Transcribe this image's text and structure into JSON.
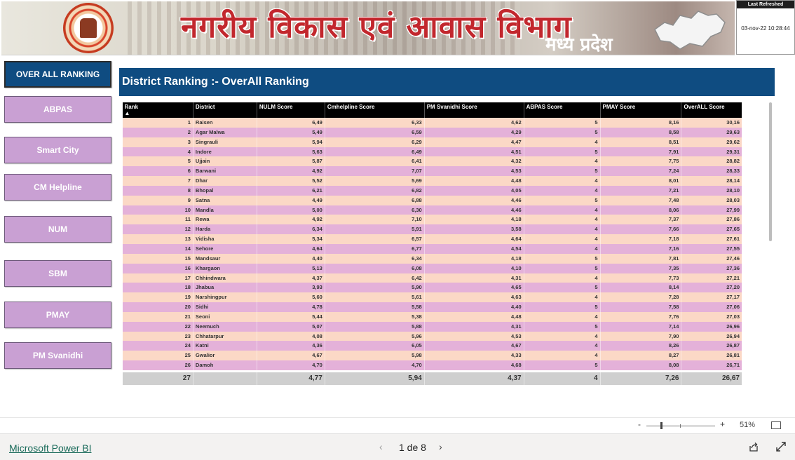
{
  "header": {
    "title_hindi": "नगरीय विकास एवं आवास विभाग",
    "subtitle_hindi": "मध्य प्रदेश",
    "last_refreshed_label": "Last Refreshed",
    "last_refreshed_value": "03-nov-22 10:28:44"
  },
  "nav": {
    "active": "OVER ALL RANKING",
    "items": [
      "ABPAS",
      "Smart City",
      "CM Helpline",
      "NUM",
      "SBM",
      "PMAY",
      "PM Svanidhi"
    ]
  },
  "page_title": "District Ranking :- OverAll Ranking",
  "table": {
    "columns": [
      "Rank",
      "District",
      "NULM Score",
      "Cmhelpline Score",
      "PM Svanidhi Score",
      "ABPAS Score",
      "PMAY Score",
      "OverALL Score"
    ],
    "rows": [
      [
        "1",
        "Raisen",
        "6,49",
        "6,33",
        "4,62",
        "5",
        "8,16",
        "30,16"
      ],
      [
        "2",
        "Agar Malwa",
        "5,49",
        "6,59",
        "4,29",
        "5",
        "8,58",
        "29,63"
      ],
      [
        "3",
        "Singrauli",
        "5,94",
        "6,29",
        "4,47",
        "4",
        "8,51",
        "29,62"
      ],
      [
        "4",
        "Indore",
        "5,63",
        "6,49",
        "4,51",
        "5",
        "7,91",
        "29,31"
      ],
      [
        "5",
        "Ujjain",
        "5,87",
        "6,41",
        "4,32",
        "4",
        "7,75",
        "28,82"
      ],
      [
        "6",
        "Barwani",
        "4,92",
        "7,07",
        "4,53",
        "5",
        "7,24",
        "28,33"
      ],
      [
        "7",
        "Dhar",
        "5,52",
        "5,69",
        "4,48",
        "4",
        "8,01",
        "28,14"
      ],
      [
        "8",
        "Bhopal",
        "6,21",
        "6,82",
        "4,05",
        "4",
        "7,21",
        "28,10"
      ],
      [
        "9",
        "Satna",
        "4,49",
        "6,88",
        "4,46",
        "5",
        "7,48",
        "28,03"
      ],
      [
        "10",
        "Mandla",
        "5,00",
        "6,30",
        "4,46",
        "4",
        "8,06",
        "27,99"
      ],
      [
        "11",
        "Rewa",
        "4,92",
        "7,10",
        "4,18",
        "4",
        "7,37",
        "27,86"
      ],
      [
        "12",
        "Harda",
        "6,34",
        "5,91",
        "3,58",
        "4",
        "7,66",
        "27,65"
      ],
      [
        "13",
        "Vidisha",
        "5,34",
        "6,57",
        "4,64",
        "4",
        "7,18",
        "27,61"
      ],
      [
        "14",
        "Sehore",
        "4,64",
        "6,77",
        "4,54",
        "4",
        "7,16",
        "27,55"
      ],
      [
        "15",
        "Mandsaur",
        "4,40",
        "6,34",
        "4,18",
        "5",
        "7,81",
        "27,46"
      ],
      [
        "16",
        "Khargaon",
        "5,13",
        "6,08",
        "4,10",
        "5",
        "7,35",
        "27,36"
      ],
      [
        "17",
        "Chhindwara",
        "4,37",
        "6,42",
        "4,31",
        "4",
        "7,73",
        "27,21"
      ],
      [
        "18",
        "Jhabua",
        "3,93",
        "5,90",
        "4,65",
        "5",
        "8,14",
        "27,20"
      ],
      [
        "19",
        "Narshingpur",
        "5,60",
        "5,61",
        "4,63",
        "4",
        "7,28",
        "27,17"
      ],
      [
        "20",
        "Sidhi",
        "4,78",
        "5,58",
        "4,40",
        "5",
        "7,58",
        "27,06"
      ],
      [
        "21",
        "Seoni",
        "5,44",
        "5,38",
        "4,48",
        "4",
        "7,76",
        "27,03"
      ],
      [
        "22",
        "Neemuch",
        "5,07",
        "5,88",
        "4,31",
        "5",
        "7,14",
        "26,96"
      ],
      [
        "23",
        "Chhatarpur",
        "4,08",
        "5,96",
        "4,53",
        "4",
        "7,90",
        "26,94"
      ],
      [
        "24",
        "Katni",
        "4,36",
        "6,05",
        "4,67",
        "4",
        "8,26",
        "26,87"
      ],
      [
        "25",
        "Gwalior",
        "4,67",
        "5,98",
        "4,33",
        "4",
        "8,27",
        "26,81"
      ],
      [
        "26",
        "Damoh",
        "4,70",
        "4,70",
        "4,68",
        "5",
        "8,08",
        "26,71"
      ]
    ],
    "total": [
      "27",
      "",
      "4,77",
      "5,94",
      "4,37",
      "4",
      "7,26",
      "26,67"
    ]
  },
  "zoom": {
    "minus": "-",
    "plus": "+",
    "percent": "51%"
  },
  "footer": {
    "brand": "Microsoft Power BI",
    "prev": "‹",
    "page": "1 de 8",
    "next": "›"
  }
}
